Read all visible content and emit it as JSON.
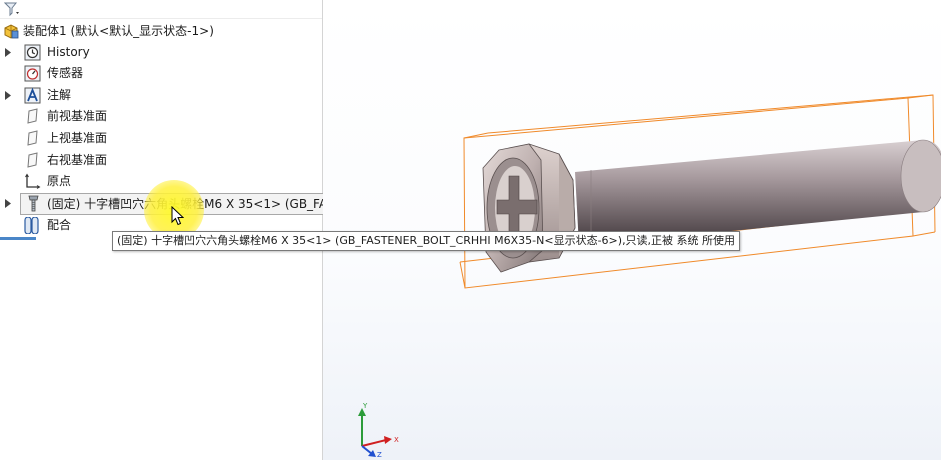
{
  "feature_tree": {
    "root": {
      "label": "装配体1  (默认<默认_显示状态-1>)",
      "icon": "assembly-icon"
    },
    "items": [
      {
        "label": "History",
        "icon": "history-icon",
        "expandable": true
      },
      {
        "label": "传感器",
        "icon": "sensor-icon",
        "expandable": false
      },
      {
        "label": "注解",
        "icon": "annotation-icon",
        "expandable": true
      },
      {
        "label": "前视基准面",
        "icon": "plane-icon",
        "expandable": false
      },
      {
        "label": "上视基准面",
        "icon": "plane-icon",
        "expandable": false
      },
      {
        "label": "右视基准面",
        "icon": "plane-icon",
        "expandable": false
      },
      {
        "label": "原点",
        "icon": "origin-icon",
        "expandable": false
      },
      {
        "label": "(固定) 十字槽凹穴六角头螺栓M6 X 35<1> (GB_FA",
        "icon": "bolt-part-icon",
        "expandable": true,
        "selected": true
      },
      {
        "label": "配合",
        "icon": "mates-icon",
        "expandable": false
      }
    ]
  },
  "tooltip": {
    "text": "(固定) 十字槽凹穴六角头螺栓M6 X 35<1> (GB_FASTENER_BOLT_CRHHI M6X35-N<显示状态-6>),只读,正被 系统 所使用"
  },
  "triad": {
    "y_label": "Y",
    "x_label": "X",
    "z_label": "Z"
  },
  "colors": {
    "bounding_box": "#f08a2a",
    "triad_y": "#2c9c3a",
    "triad_x": "#d02020",
    "triad_z": "#2050d0",
    "highlight": "#fff43a",
    "selection_accent": "#4a86c8"
  }
}
